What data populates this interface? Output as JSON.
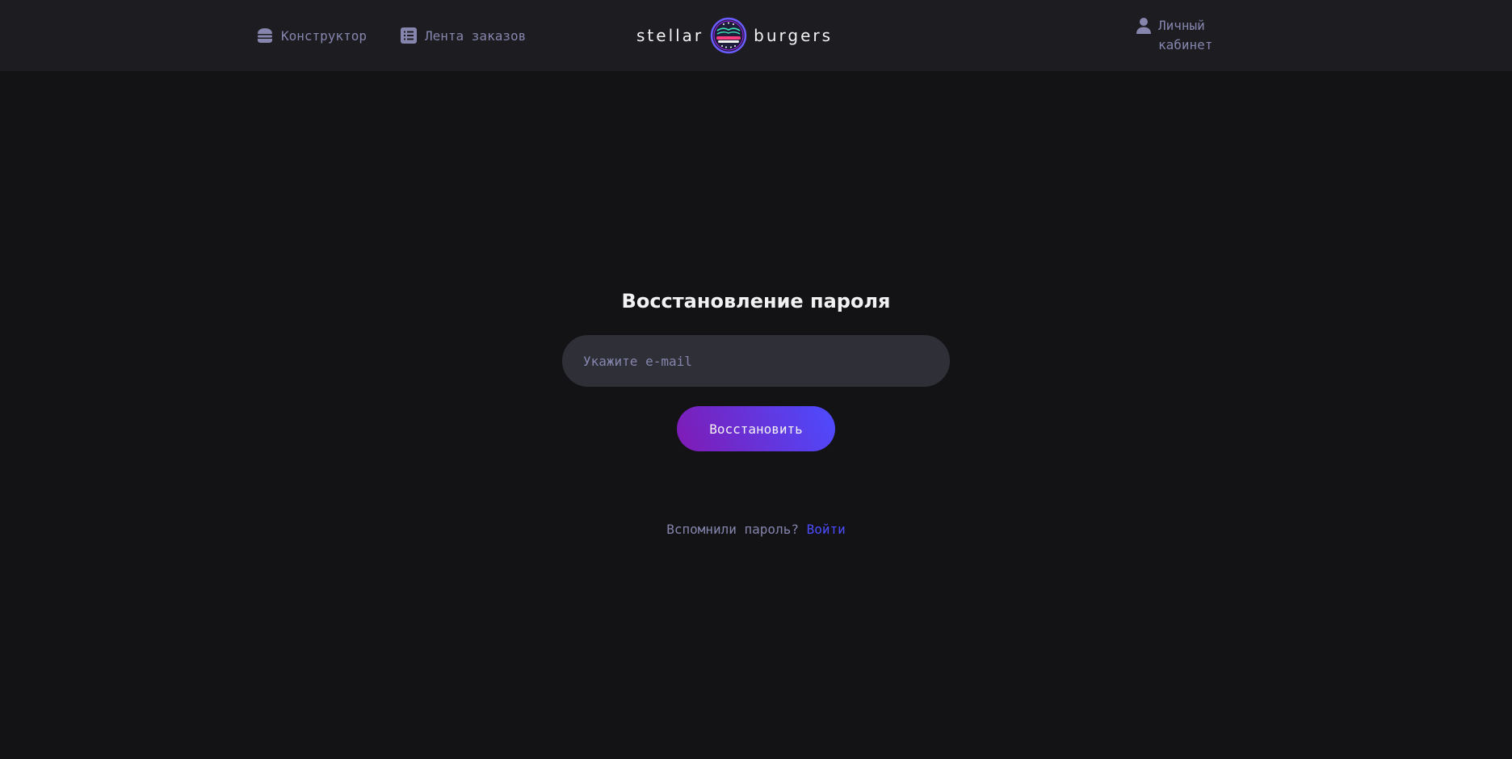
{
  "header": {
    "nav": {
      "constructor_label": "Конструктор",
      "feed_label": "Лента заказов",
      "profile_label": "Личный кабинет"
    },
    "logo": {
      "left_text": "stellar",
      "right_text": "burgers"
    }
  },
  "form": {
    "title": "Восстановление пароля",
    "email_placeholder": "Укажите e-mail",
    "email_value": "",
    "submit_label": "Восстановить",
    "remember_text": "Вспомнили пароль?",
    "login_link_label": "Войти"
  },
  "icons": {
    "constructor": "burger-icon",
    "feed": "list-icon",
    "profile": "profile-icon",
    "logo": "burger-logo-emblem"
  },
  "colors": {
    "background": "#131316",
    "header_background": "#1c1c21",
    "inactive_text": "#8585ad",
    "primary_text": "#f2f2f3",
    "accent": "#4c4cff",
    "button_gradient_start": "#801ab3",
    "button_gradient_end": "#4c4cff",
    "input_background": "#2f2f37"
  }
}
